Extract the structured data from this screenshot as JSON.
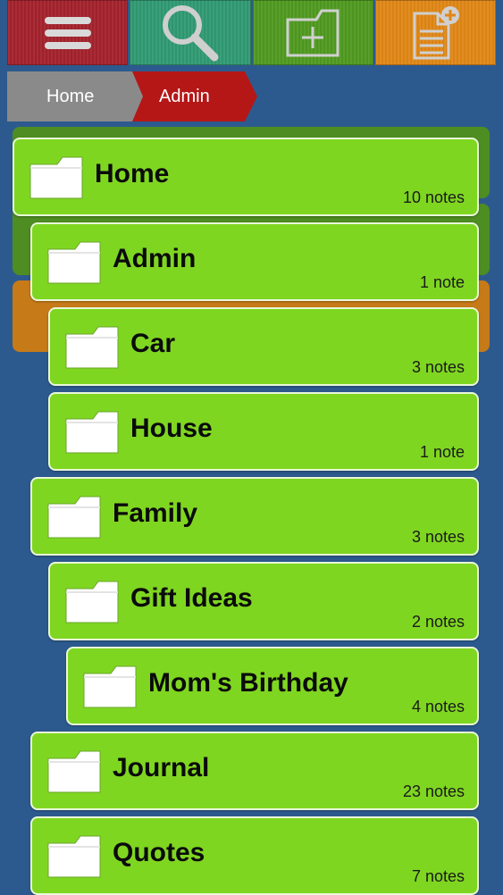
{
  "colors": {
    "background": "#2d5a8e",
    "menu_tile": "#a3222c",
    "search_tile": "#2f9a73",
    "new_folder_tile": "#4f9a20",
    "new_note_tile": "#e08716",
    "breadcrumb_inactive": "#8a8a8a",
    "breadcrumb_active": "#b51717",
    "row_fill": "#7fd621"
  },
  "toolbar": {
    "buttons": [
      {
        "id": "menu",
        "icon": "hamburger-menu-icon"
      },
      {
        "id": "search",
        "icon": "magnifier-icon"
      },
      {
        "id": "new-folder",
        "icon": "folder-plus-icon"
      },
      {
        "id": "new-note",
        "icon": "note-plus-icon"
      }
    ]
  },
  "breadcrumb": {
    "items": [
      {
        "label": "Home"
      },
      {
        "label": "Admin"
      }
    ]
  },
  "folders": [
    {
      "name": "Home",
      "count": "10 notes",
      "depth": 0
    },
    {
      "name": "Admin",
      "count": "1 note",
      "depth": 1
    },
    {
      "name": "Car",
      "count": "3 notes",
      "depth": 2
    },
    {
      "name": "House",
      "count": "1 note",
      "depth": 2
    },
    {
      "name": "Family",
      "count": "3 notes",
      "depth": 1
    },
    {
      "name": "Gift Ideas",
      "count": "2 notes",
      "depth": 2
    },
    {
      "name": "Mom's Birthday",
      "count": "4 notes",
      "depth": 3
    },
    {
      "name": "Journal",
      "count": "23 notes",
      "depth": 1
    },
    {
      "name": "Quotes",
      "count": "7 notes",
      "depth": 1
    }
  ]
}
